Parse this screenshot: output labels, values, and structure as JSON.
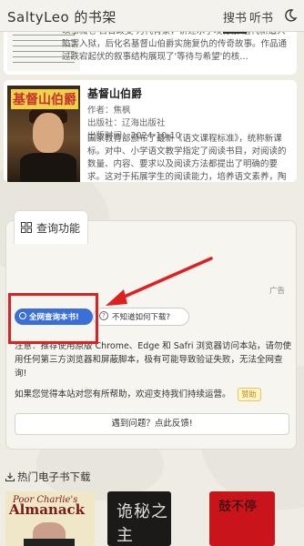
{
  "header": {
    "title": "SaltyLeo 的书架",
    "tabs": [
      {
        "label": "搜书",
        "active": true
      },
      {
        "label": "听书",
        "active": false
      }
    ],
    "icon": "moon-icon"
  },
  "books": [
    {
      "description": "以事械仑'百日政变'为代背景，讲述水手埃德蒙·唐代新遭人陷害入狱，后化名基督山伯爵实施复仇的传奇故事。作品通过跌宕起伏的叙事结构展现了'等待与希望'的核…"
    },
    {
      "title": "基督山伯爵",
      "author": "作者：焦枫",
      "publisher": "出版社：辽海出版社",
      "date": "出版时间：2024-10-10",
      "description": "国家教育部颁布了最新《语文课程标准》，统称新课标。对中、小学语文教学指定了阅读书目，对阅读的数量、内容、要求以及阅读方法都提出了明确的要求。这对于拓展学生的阅读能力，培养语文素养，陶冶情操，促进学生持身…",
      "cover_text": "基督山伯爵"
    }
  ],
  "query": {
    "title": "查询功能",
    "ad_label": "广告",
    "query_button": "全网查询本书!",
    "help_button": "不知道如何下载?",
    "tip_prefix": "注意：",
    "tip": "推荐使用原版 Chrome、Edge 和 Safri 浏览器访问本站，请勿使用任何第三方浏览器和屏蔽脚本，极有可能导致验证失败，无法全网查询!",
    "support_text": "如果您觉得本站对您有所帮助，欢迎支持我们持续运营。",
    "donate_button": "赞助",
    "feedback_button": "遇到问题？点此反馈!"
  },
  "hot": {
    "title": "热门电子书下载",
    "books": [
      {
        "line1": "Poor Charlie's",
        "line2": "Almanack"
      },
      {
        "text": "诡秘之主"
      },
      {
        "text": "鼓不停"
      }
    ]
  },
  "colors": {
    "background": "#efece3",
    "query_button": "#3a6fd8",
    "highlight": "#e02020"
  }
}
